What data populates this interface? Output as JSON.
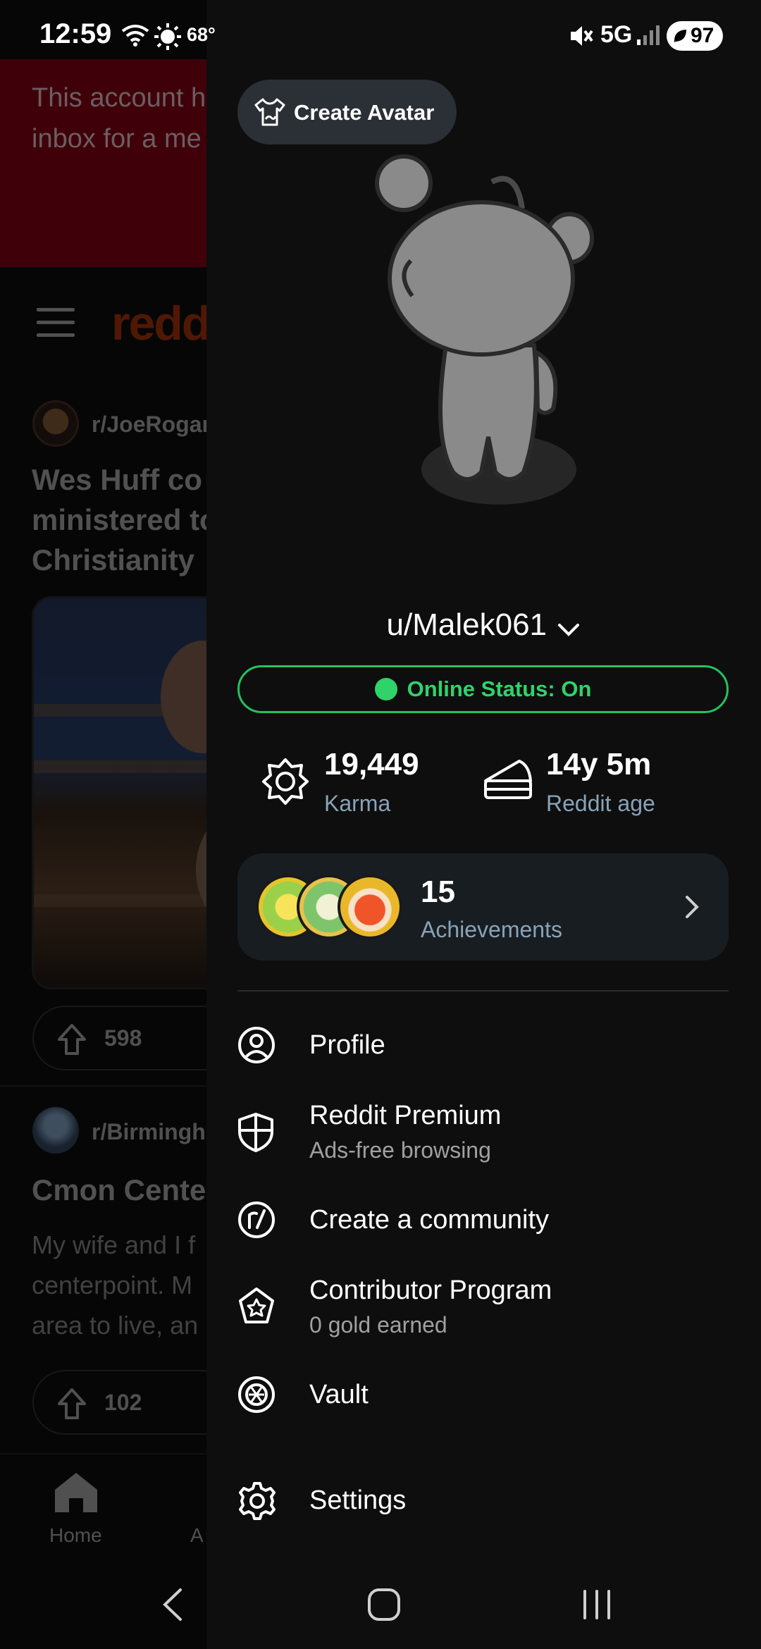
{
  "status_bar": {
    "time": "12:59",
    "temperature": "68°",
    "network": "5G",
    "battery": "97"
  },
  "background": {
    "banner_text": "This account h\ninbox for a me",
    "logo_text": "redd",
    "posts": [
      {
        "subreddit": "r/JoeRogar",
        "title": "Wes Huff co\nministered to\nChristianity",
        "votes": "598"
      },
      {
        "subreddit": "r/Birmingh",
        "title": "Cmon Cente",
        "body": "My wife and I f\ncenterpoint. M\narea to live, an",
        "votes": "102"
      }
    ],
    "bottom_nav": {
      "home_label": "Home",
      "next_label_fragment": "A"
    }
  },
  "drawer": {
    "create_avatar_label": "Create Avatar",
    "username": "u/Malek061",
    "online_status": "Online Status: On",
    "stats": {
      "karma_value": "19,449",
      "karma_label": "Karma",
      "age_value": "14y 5m",
      "age_label": "Reddit age"
    },
    "achievements": {
      "count": "15",
      "label": "Achievements"
    },
    "menu": [
      {
        "label": "Profile",
        "sublabel": ""
      },
      {
        "label": "Reddit Premium",
        "sublabel": "Ads-free browsing"
      },
      {
        "label": "Create a community",
        "sublabel": ""
      },
      {
        "label": "Contributor Program",
        "sublabel": "0 gold earned"
      },
      {
        "label": "Vault",
        "sublabel": ""
      },
      {
        "label": "Settings",
        "sublabel": ""
      }
    ]
  },
  "colors": {
    "online_green": "#2fd36a",
    "drawer_bg": "#0e0e0e",
    "card_bg": "#181d22",
    "muted_label": "#88a3b8"
  }
}
